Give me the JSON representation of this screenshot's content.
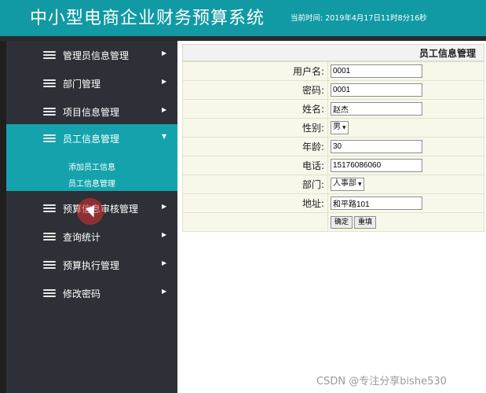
{
  "header": {
    "title": "中小型电商企业财务预算系统",
    "time_label": "当前时间:",
    "time_value": "2019年4月17日11时8分16秒"
  },
  "sidebar": {
    "items": [
      {
        "label": "管理员信息管理",
        "icon": "stack-icon"
      },
      {
        "label": "部门管理",
        "icon": "stack-icon"
      },
      {
        "label": "项目信息管理",
        "icon": "stack-icon"
      },
      {
        "label": "员工信息管理",
        "icon": "stack-icon",
        "expanded": true
      },
      {
        "label": "预算信息审核管理",
        "icon": "stack-icon"
      },
      {
        "label": "查询统计",
        "icon": "stack-icon"
      },
      {
        "label": "预算执行管理",
        "icon": "stack-icon"
      },
      {
        "label": "修改密码",
        "icon": "stack-icon"
      }
    ],
    "submenu": [
      "添加员工信息",
      "员工信息管理"
    ]
  },
  "panel": {
    "title": "员工信息管理",
    "fields": [
      {
        "label": "用户名:",
        "value": "0001"
      },
      {
        "label": "密码:",
        "value": "0001"
      },
      {
        "label": "姓名:",
        "value": "赵杰"
      },
      {
        "label": "性别:",
        "value": "男"
      },
      {
        "label": "年龄:",
        "value": "30"
      },
      {
        "label": "电话:",
        "value": "15176086060"
      },
      {
        "label": "部门:",
        "value": "人事部"
      },
      {
        "label": "地址:",
        "value": "和平路101"
      }
    ],
    "confirm_label": "确定",
    "reset_label": "重填"
  },
  "watermark": "CSDN @专注分享bishe530",
  "colors": {
    "header_bg": "#119aa4",
    "sidebar_bg": "#2d3036",
    "active_bg": "#14a3ad",
    "form_bg": "#f7f7ea"
  }
}
